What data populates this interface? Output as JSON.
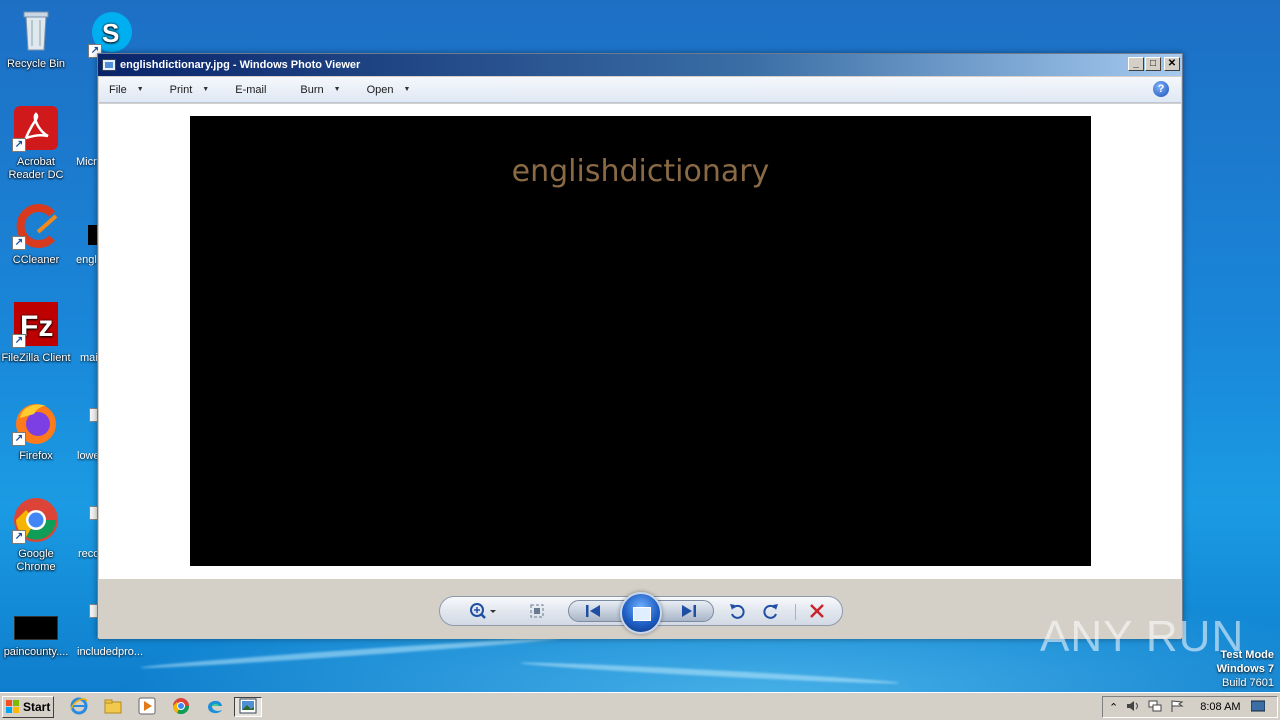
{
  "desktop": {
    "icons": [
      {
        "label": "Recycle Bin",
        "icon": "recycle-bin-icon"
      },
      {
        "label": "Acrobat Reader DC",
        "icon": "acrobat-icon"
      },
      {
        "label": "CCleaner",
        "icon": "ccleaner-icon"
      },
      {
        "label": "FileZilla Client",
        "icon": "filezilla-icon"
      },
      {
        "label": "Firefox",
        "icon": "firefox-icon"
      },
      {
        "label": "Google Chrome",
        "icon": "chrome-icon"
      },
      {
        "label": "paincounty....",
        "icon": "image-file-icon"
      }
    ],
    "partial_icons": [
      {
        "label": "Micr",
        "icon": "edge-icon"
      },
      {
        "label": "engl",
        "icon": "image-file-icon"
      },
      {
        "label": "mai",
        "icon": "file-icon"
      },
      {
        "label": "lowe",
        "icon": "file-icon"
      },
      {
        "label": "reco",
        "icon": "file-icon"
      },
      {
        "label": "includedpro...",
        "icon": "file-icon"
      }
    ],
    "skype_icon": "skype-icon"
  },
  "window": {
    "title": "englishdictionary.jpg - Windows Photo Viewer",
    "buttons": {
      "minimize": "_",
      "maximize": "□",
      "close": "✕"
    },
    "menu": [
      {
        "label": "File",
        "has_dropdown": true
      },
      {
        "label": "Print",
        "has_dropdown": true
      },
      {
        "label": "E-mail",
        "has_dropdown": false
      },
      {
        "label": "Burn",
        "has_dropdown": true
      },
      {
        "label": "Open",
        "has_dropdown": true
      }
    ],
    "help": "?",
    "image_text": "englishdictionary",
    "controls": {
      "zoom": "zoom-icon",
      "actual_size": "actual-size-icon",
      "previous": "previous-icon",
      "slideshow": "slideshow-icon",
      "next": "next-icon",
      "rotate_ccw": "rotate-counterclockwise-icon",
      "rotate_cw": "rotate-clockwise-icon",
      "delete": "delete-icon"
    }
  },
  "taskbar": {
    "start_label": "Start",
    "pinned": [
      "internet-explorer-icon",
      "explorer-icon",
      "media-player-icon",
      "chrome-icon",
      "edge-icon",
      "photo-viewer-icon"
    ],
    "clock": "8:08 AM"
  },
  "watermark": {
    "brand": "ANY RUN",
    "line1": "Test Mode",
    "line2": "Windows 7",
    "line3": "Build 7601"
  },
  "colors": {
    "desktop_top": "#1d6fc4",
    "title_active": "#0a246a",
    "image_text": "#8a6a45",
    "window_face": "#d4d0c8"
  }
}
